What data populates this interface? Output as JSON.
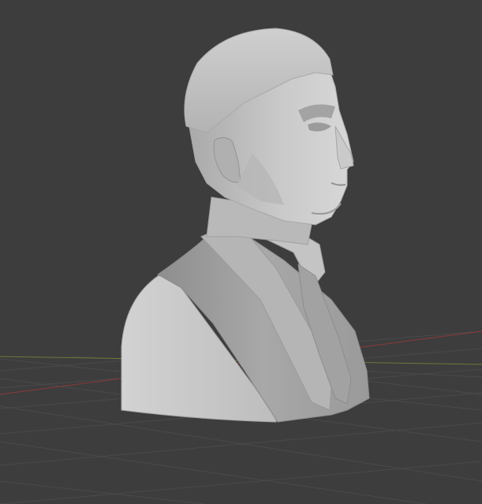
{
  "viewport": {
    "background_color": "#3d3d3d",
    "grid_color": "#4a4a4a",
    "x_axis_color": "#8a3a3a",
    "y_axis_color": "#6b7a3a",
    "mesh_color": "#b8b8b8",
    "object_subject": "bust"
  }
}
